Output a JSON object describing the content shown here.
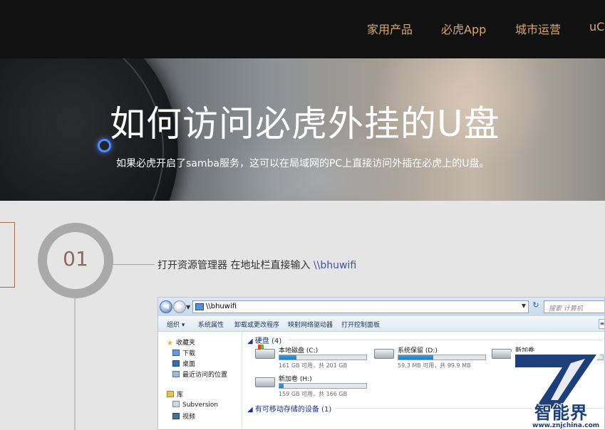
{
  "nav": {
    "items": [
      "家用产品",
      "必虎App",
      "城市运营",
      "uC"
    ]
  },
  "hero": {
    "title": "如何访问必虎外挂的U盘",
    "subtitle": "如果必虎开启了samba服务，这可以在局域网的PC上直接访问外插在必虎上的U盘。"
  },
  "step": {
    "number": "01",
    "text": "打开资源管理器 在地址栏直接输入 ",
    "link": "\\\\bhuwifi"
  },
  "explorer": {
    "address": "\\\\bhuwifi",
    "search_placeholder": "搜索 计算机",
    "toolbar": [
      "组织 ▾",
      "系统属性",
      "卸载或更改程序",
      "映射网络驱动器",
      "打开控制面板"
    ],
    "nav": {
      "favorites": "收藏夹",
      "downloads": "下载",
      "desktop": "桌面",
      "recent": "最近访问的位置",
      "libraries": "库",
      "subversion": "Subversion",
      "videos": "视频"
    },
    "hard_disks_title": "硬盘 (4)",
    "removable_title": "有可移动存储的设备 (1)",
    "drives": [
      {
        "name": "本地磁盘 (C:)",
        "info": "161 GB 可用，共 201 GB",
        "used_fraction": 0.2
      },
      {
        "name": "系统保留 (D:)",
        "info": "59.3 MB 可用，共 99.9 MB",
        "used_fraction": 0.4
      },
      {
        "name": "新加卷 (H:)",
        "info": "159 GB 可用，共 166 GB",
        "used_fraction": 0.05
      },
      {
        "name": "新加卷",
        "info": "",
        "used_fraction": 0.3
      }
    ]
  },
  "watermark": {
    "brand": "智能界",
    "url": "www.znjchina.com"
  },
  "colors": {
    "nav_bg": "#111111",
    "nav_text": "#d7a86e",
    "content_bg": "#e4e5e4",
    "step_number": "#8a6a5b",
    "link": "#3a55a0",
    "watermark": "#1d3f7a"
  }
}
